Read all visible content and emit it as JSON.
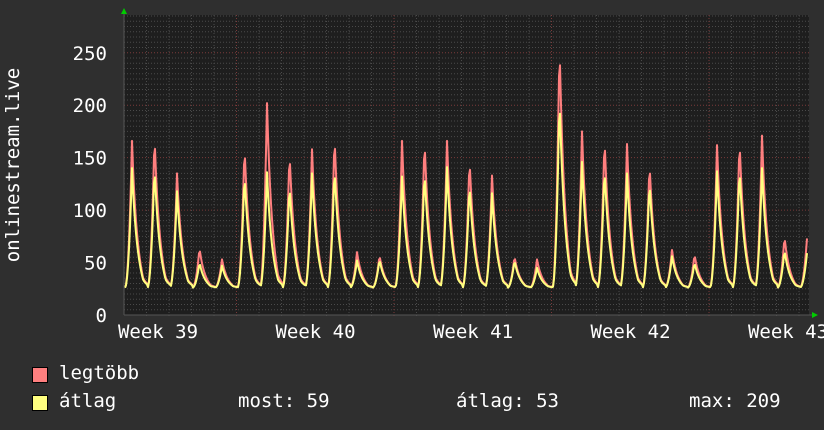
{
  "chart_data": {
    "type": "line",
    "ylabel": "onlinestream.live",
    "ylim": [
      0,
      286
    ],
    "yticks": [
      "0",
      "50",
      "100",
      "150",
      "200",
      "250"
    ],
    "xticks": [
      "Week 39",
      "Week 40",
      "Week 41",
      "Week 42",
      "Week 43"
    ],
    "grid": true,
    "legend_position": "bottom-left",
    "baseline": 26,
    "series": [
      {
        "name": "legtöbb",
        "color": "#ff7f7f",
        "daily_peaks": [
          166,
          172,
          135,
          64,
          53,
          162,
          202,
          156,
          158,
          172,
          60,
          57,
          166,
          168,
          166,
          150,
          133,
          56,
          53,
          260,
          175,
          170,
          163,
          146,
          62,
          58,
          162,
          168,
          171,
          75,
          73
        ]
      },
      {
        "name": "átlag",
        "color": "#ffff7f",
        "daily_peaks": [
          140,
          142,
          118,
          50,
          47,
          135,
          136,
          125,
          135,
          141,
          52,
          53,
          132,
          138,
          141,
          126,
          116,
          52,
          45,
          209,
          146,
          141,
          135,
          128,
          56,
          50,
          137,
          141,
          140,
          62,
          59
        ]
      }
    ],
    "legend_stats": {
      "most_label": "most:",
      "most": "59",
      "atlag_label": "átlag:",
      "atlag": "53",
      "max_label": "max:",
      "max": "209"
    }
  }
}
